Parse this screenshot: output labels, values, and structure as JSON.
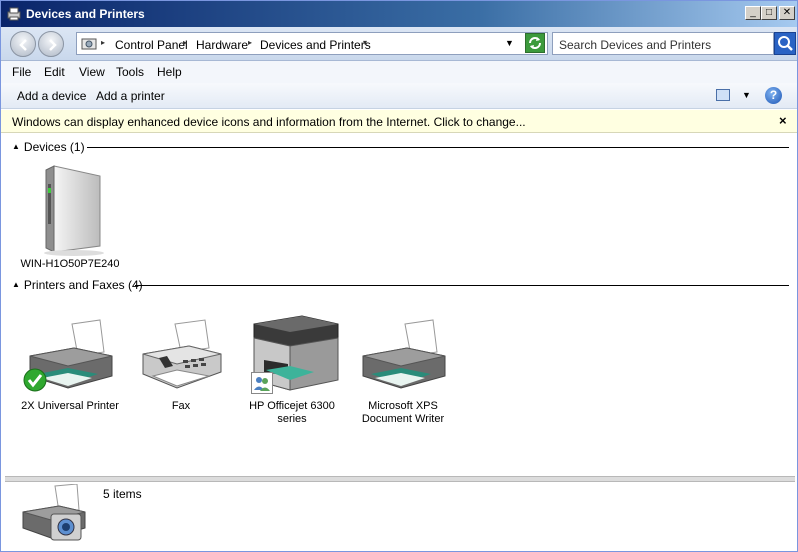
{
  "window": {
    "title": "Devices and Printers",
    "controls": {
      "minimize": "_",
      "maximize": "□",
      "close": "✕"
    }
  },
  "address": {
    "crumbs": [
      "Control Panel",
      "Hardware",
      "Devices and Printers"
    ],
    "search_placeholder": "Search Devices and Printers"
  },
  "menu": [
    "File",
    "Edit",
    "View",
    "Tools",
    "Help"
  ],
  "commands": {
    "add_device": "Add a device",
    "add_printer": "Add a printer",
    "help": "?"
  },
  "infobar": {
    "text": "Windows can display enhanced device icons and information from the Internet. Click to change...",
    "close": "×"
  },
  "groups": {
    "devices": {
      "title": "Devices (1)",
      "items": [
        {
          "label": "WIN-H1O50P7E240",
          "icon": "computer-tower-icon"
        }
      ]
    },
    "printers": {
      "title": "Printers and Faxes (4)",
      "items": [
        {
          "label": "2X Universal Printer",
          "icon": "printer-icon",
          "badge": "default-check-icon"
        },
        {
          "label": "Fax",
          "icon": "fax-icon"
        },
        {
          "label": "HP Officejet 6300 series",
          "icon": "multifunction-printer-icon",
          "badge": "shared-users-icon"
        },
        {
          "label": "Microsoft XPS Document Writer",
          "icon": "printer-icon"
        }
      ]
    }
  },
  "details": {
    "count": "5 items",
    "icon": "printer-camera-icon"
  },
  "colors": {
    "titlebar": "#0a246a",
    "infobar": "#ffffe1",
    "checkmark": "#2fa82f"
  }
}
